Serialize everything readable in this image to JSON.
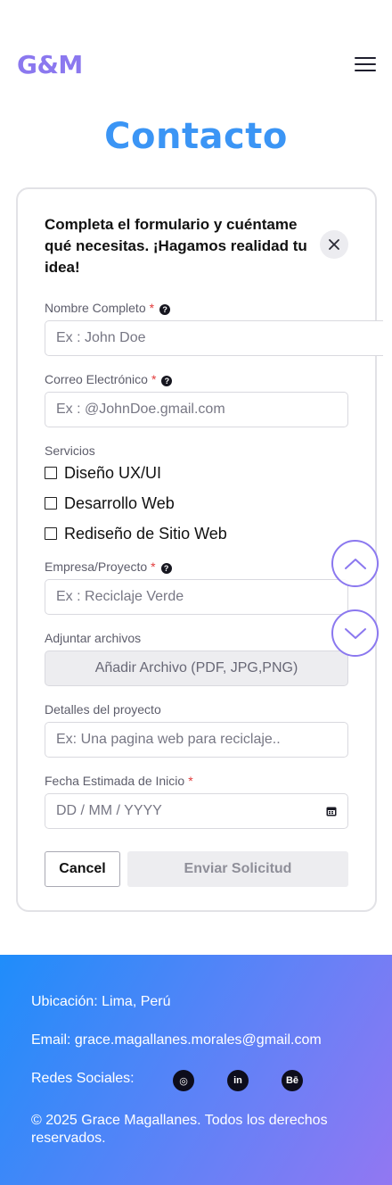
{
  "header": {
    "logo": "G&M",
    "menu_icon": "hamburger-menu-icon"
  },
  "page": {
    "title": "Contacto"
  },
  "form": {
    "heading": "Completa el formulario y cuéntame qué necesitas. ¡Hagamos realidad tu idea!",
    "close_icon": "close-icon",
    "required_mark": "*",
    "help_glyph": "?",
    "name": {
      "label": "Nombre Completo",
      "placeholder": "Ex : John Doe"
    },
    "email": {
      "label": "Correo Electrónico",
      "placeholder": "Ex : @JohnDoe.gmail.com"
    },
    "services": {
      "label": "Servicios",
      "options": [
        "Diseño UX/UI",
        "Desarrollo Web",
        "Rediseño de Sitio Web"
      ]
    },
    "company": {
      "label": "Empresa/Proyecto",
      "placeholder": "Ex : Reciclaje Verde"
    },
    "attachments": {
      "label": "Adjuntar archivos",
      "button": "Añadir Archivo (PDF, JPG,PNG)"
    },
    "details": {
      "label": "Detalles del proyecto",
      "placeholder": "Ex: Una pagina web para reciclaje.."
    },
    "start_date": {
      "label": "Fecha Estimada de Inicio",
      "placeholder": "DD / MM / YYYY",
      "icon": "calendar-icon"
    },
    "cancel_label": "Cancel",
    "submit_label": "Enviar Solicitud"
  },
  "scroll": {
    "up_icon": "chevron-up-icon",
    "down_icon": "chevron-down-icon"
  },
  "footer": {
    "location": "Ubicación: Lima, Perú",
    "email": "Email: grace.magallanes.morales@gmail.com",
    "social_label": "Redes Sociales:",
    "social": [
      {
        "icon": "instagram-icon",
        "glyph": "◎"
      },
      {
        "icon": "linkedin-icon",
        "glyph": "in"
      },
      {
        "icon": "behance-icon",
        "glyph": "Bē"
      }
    ],
    "copyright": " © 2025 Grace Magallanes. Todos los derechos reservados."
  },
  "colors": {
    "brand_purple": "#8b78ef",
    "title_blue": "#3b95f5",
    "required_red": "#e23b3b",
    "footer_gradient_start": "#1f8dfa",
    "footer_gradient_end": "#9277f2"
  }
}
